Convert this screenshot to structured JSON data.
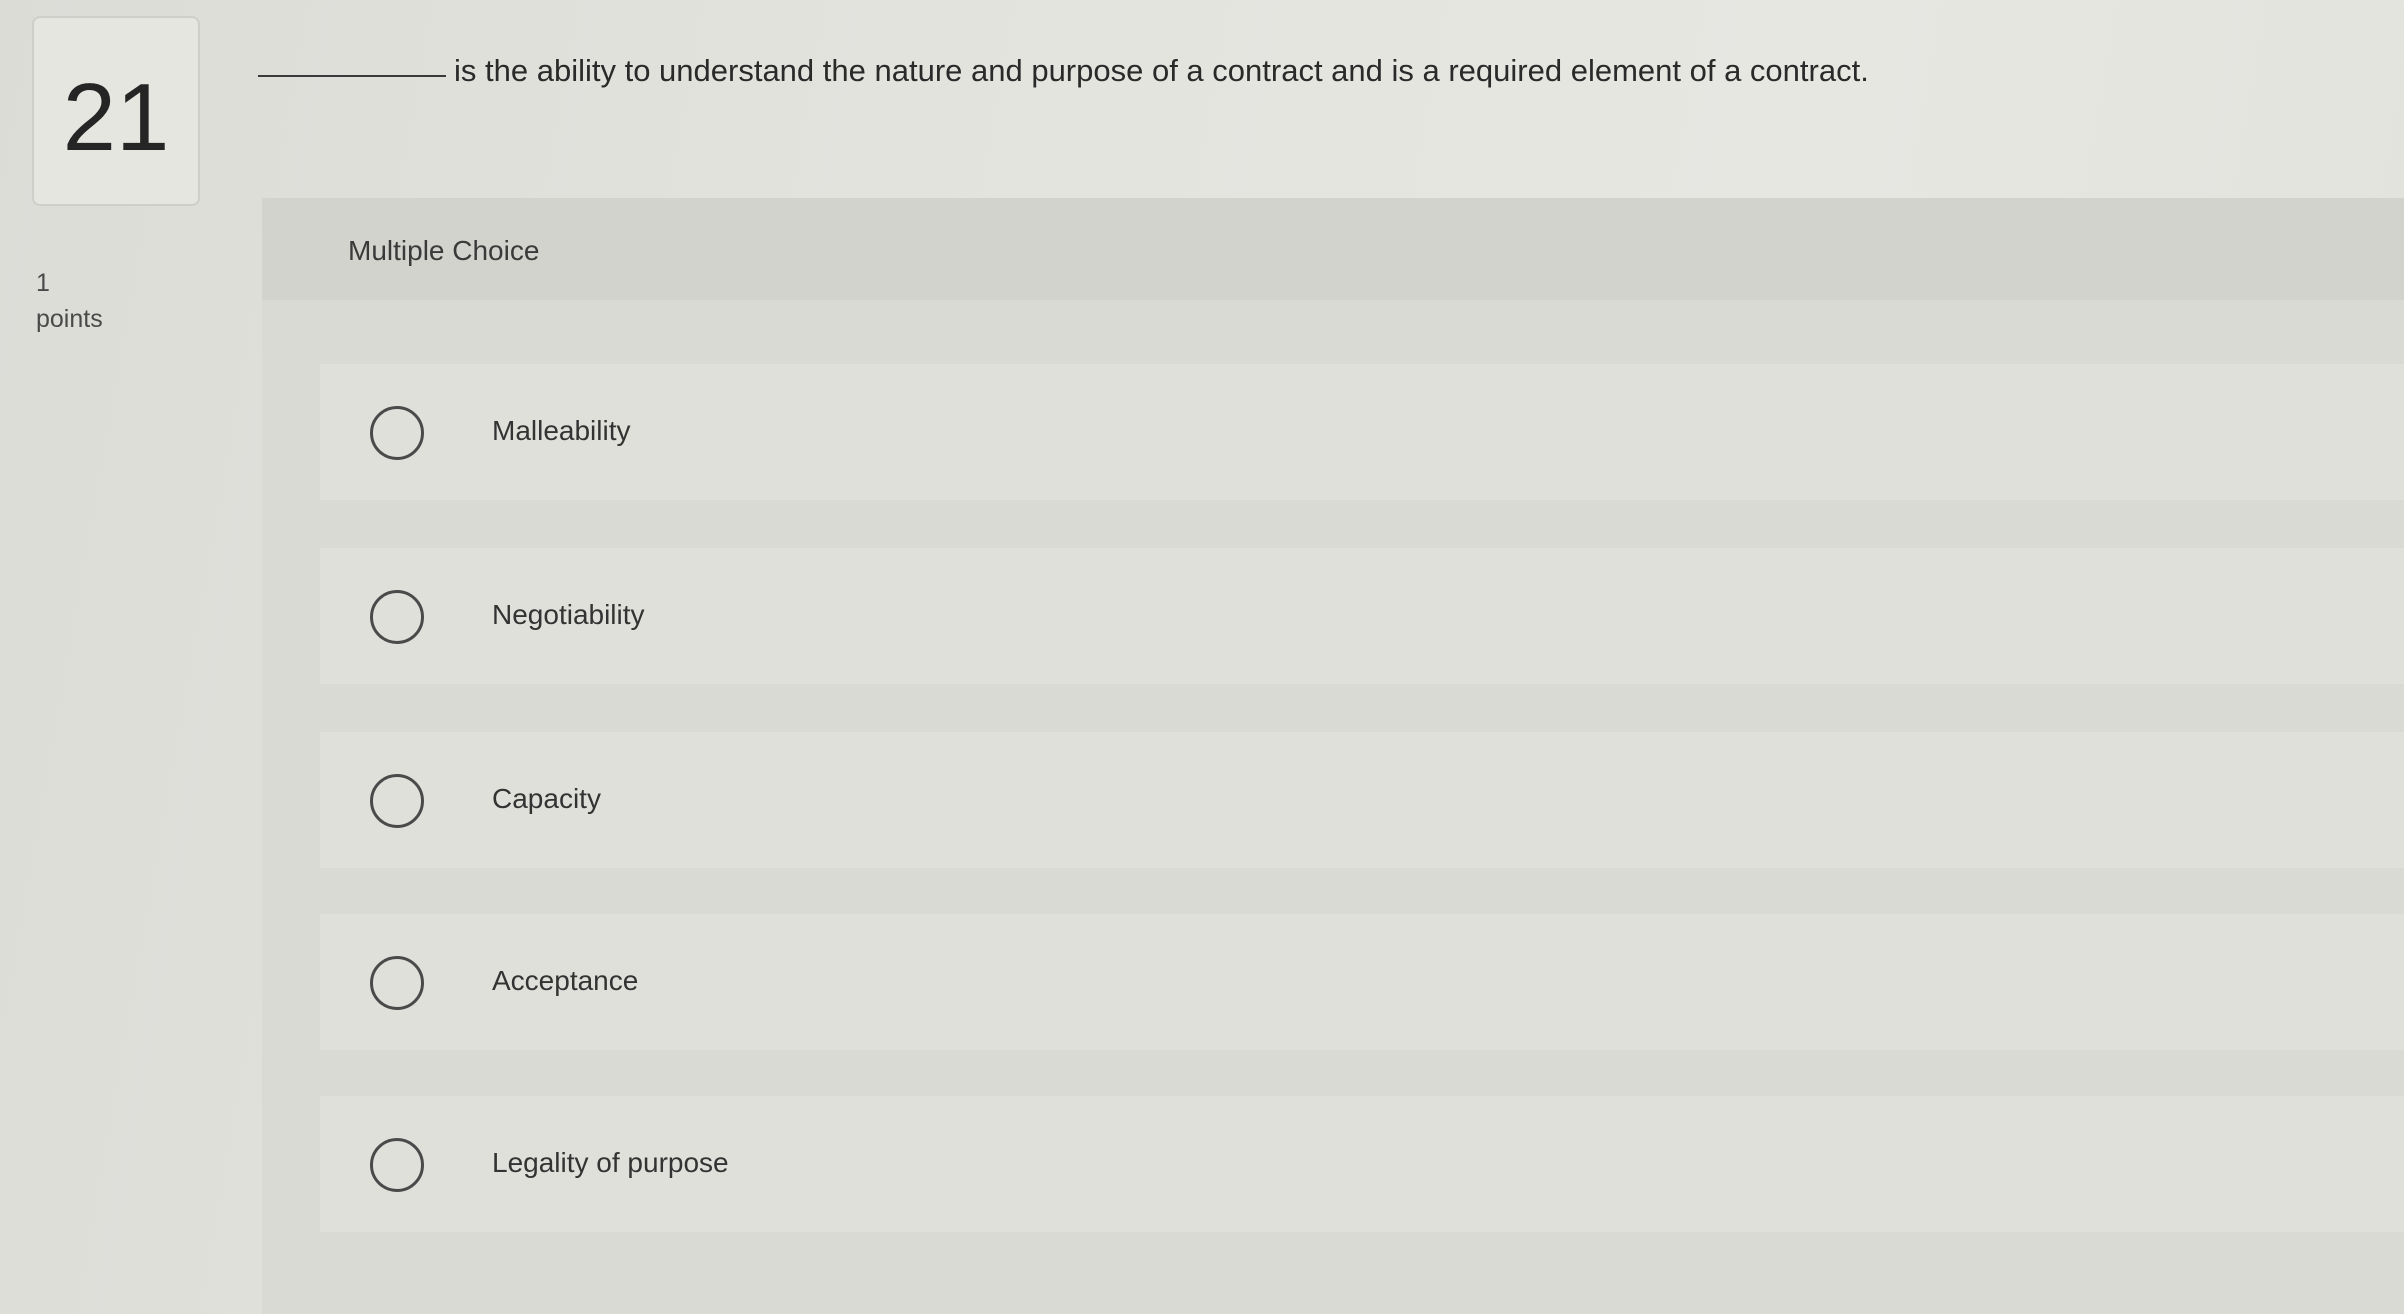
{
  "question": {
    "number": "21",
    "points_value": "1",
    "points_label": "points",
    "text": "is the ability to understand the nature and purpose of a contract and is a required element of a contract."
  },
  "answer_panel": {
    "type_label": "Multiple Choice",
    "choices": [
      {
        "label": "Malleability",
        "selected": false
      },
      {
        "label": "Negotiability",
        "selected": false
      },
      {
        "label": "Capacity",
        "selected": false
      },
      {
        "label": "Acceptance",
        "selected": false
      },
      {
        "label": "Legality of purpose",
        "selected": false
      }
    ]
  },
  "colors": {
    "panel_background": "#dadad4",
    "choice_background": "#e0e0db",
    "text": "#2f2f2f"
  }
}
